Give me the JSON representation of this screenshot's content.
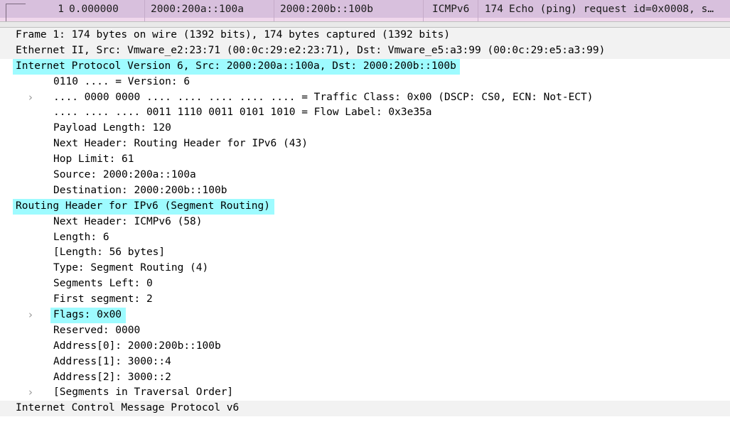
{
  "packet_list": {
    "selected_row": {
      "no": "1",
      "time": "0.000000",
      "source": "2000:200a::100a",
      "destination": "2000:200b::100b",
      "protocol": "ICMPv6",
      "length": "174",
      "info": "Echo (ping) request id=0x0008, s…"
    },
    "selected_row_color": "#d8c0dd"
  },
  "colors": {
    "highlight": "#9efbff",
    "row_alt": "#f2f2f2",
    "background": "#ffffff"
  },
  "detail_tree": {
    "rows": [
      {
        "text": "Frame 1: 174 bytes on wire (1392 bits), 174 bytes captured (1392 bits)",
        "twisty": "collapsed",
        "twisty_icon": "chevron-right-icon",
        "name": "frame-node"
      },
      {
        "text": "Ethernet II, Src: Vmware_e2:23:71 (00:0c:29:e2:23:71), Dst: Vmware_e5:a3:99 (00:0c:29:e5:a3:99)",
        "twisty": "collapsed",
        "twisty_icon": "chevron-right-icon",
        "name": "ethernet-node"
      },
      {
        "text": "Internet Protocol Version 6, Src: 2000:200a::100a, Dst: 2000:200b::100b",
        "twisty": "expanded",
        "twisty_icon": "chevron-down-icon",
        "name": "ipv6-node"
      },
      {
        "text": "0110 .... = Version: 6",
        "twisty": "none",
        "twisty_icon": "",
        "name": "ipv6-version-field"
      },
      {
        "text": ".... 0000 0000 .... .... .... .... .... = Traffic Class: 0x00 (DSCP: CS0, ECN: Not-ECT)",
        "twisty": "collapsed",
        "twisty_icon": "chevron-right-icon",
        "name": "ipv6-traffic-class-field"
      },
      {
        "text": ".... .... .... 0011 1110 0011 0101 1010 = Flow Label: 0x3e35a",
        "twisty": "none",
        "twisty_icon": "",
        "name": "ipv6-flow-label-field"
      },
      {
        "text": "Payload Length: 120",
        "twisty": "none",
        "twisty_icon": "",
        "name": "ipv6-payload-length-field"
      },
      {
        "text": "Next Header: Routing Header for IPv6 (43)",
        "twisty": "none",
        "twisty_icon": "",
        "name": "ipv6-next-header-field"
      },
      {
        "text": "Hop Limit: 61",
        "twisty": "none",
        "twisty_icon": "",
        "name": "ipv6-hop-limit-field"
      },
      {
        "text": "Source: 2000:200a::100a",
        "twisty": "none",
        "twisty_icon": "",
        "name": "ipv6-source-field"
      },
      {
        "text": "Destination: 2000:200b::100b",
        "twisty": "none",
        "twisty_icon": "",
        "name": "ipv6-destination-field"
      },
      {
        "text": "Routing Header for IPv6 (Segment Routing)",
        "twisty": "expanded",
        "twisty_icon": "chevron-down-icon",
        "name": "routing-header-node"
      },
      {
        "text": "Next Header: ICMPv6 (58)",
        "twisty": "none",
        "twisty_icon": "",
        "name": "rh-next-header-field"
      },
      {
        "text": "Length: 6",
        "twisty": "none",
        "twisty_icon": "",
        "name": "rh-length-field"
      },
      {
        "text": "[Length: 56 bytes]",
        "twisty": "none",
        "twisty_icon": "",
        "name": "rh-length-bytes-field"
      },
      {
        "text": "Type: Segment Routing (4)",
        "twisty": "none",
        "twisty_icon": "",
        "name": "rh-type-field"
      },
      {
        "text": "Segments Left: 0",
        "twisty": "none",
        "twisty_icon": "",
        "name": "rh-segments-left-field"
      },
      {
        "text": "First segment: 2",
        "twisty": "none",
        "twisty_icon": "",
        "name": "rh-first-segment-field"
      },
      {
        "text": "Flags: 0x00",
        "twisty": "collapsed",
        "twisty_icon": "chevron-right-icon",
        "name": "rh-flags-field"
      },
      {
        "text": "Reserved: 0000",
        "twisty": "none",
        "twisty_icon": "",
        "name": "rh-reserved-field"
      },
      {
        "text": "Address[0]: 2000:200b::100b",
        "twisty": "none",
        "twisty_icon": "",
        "name": "rh-address-0-field"
      },
      {
        "text": "Address[1]: 3000::4",
        "twisty": "none",
        "twisty_icon": "",
        "name": "rh-address-1-field"
      },
      {
        "text": "Address[2]: 3000::2",
        "twisty": "none",
        "twisty_icon": "",
        "name": "rh-address-2-field"
      },
      {
        "text": "[Segments in Traversal Order]",
        "twisty": "collapsed",
        "twisty_icon": "chevron-right-icon",
        "name": "rh-segments-traversal-node"
      },
      {
        "text": "Internet Control Message Protocol v6",
        "twisty": "collapsed",
        "twisty_icon": "chevron-right-icon",
        "name": "icmpv6-node"
      }
    ],
    "layout": {
      "indents": [
        0,
        0,
        0,
        1,
        1,
        1,
        1,
        1,
        1,
        1,
        1,
        0,
        1,
        1,
        1,
        1,
        1,
        1,
        1,
        1,
        1,
        1,
        1,
        1,
        0
      ],
      "highlighted": [
        false,
        false,
        true,
        false,
        false,
        false,
        false,
        false,
        false,
        false,
        false,
        true,
        false,
        false,
        false,
        false,
        false,
        false,
        true,
        false,
        false,
        false,
        false,
        false,
        false
      ],
      "alt_bg": [
        true,
        true,
        false,
        false,
        false,
        false,
        false,
        false,
        false,
        false,
        false,
        false,
        false,
        false,
        false,
        false,
        false,
        false,
        false,
        false,
        false,
        false,
        false,
        false,
        true
      ]
    }
  }
}
